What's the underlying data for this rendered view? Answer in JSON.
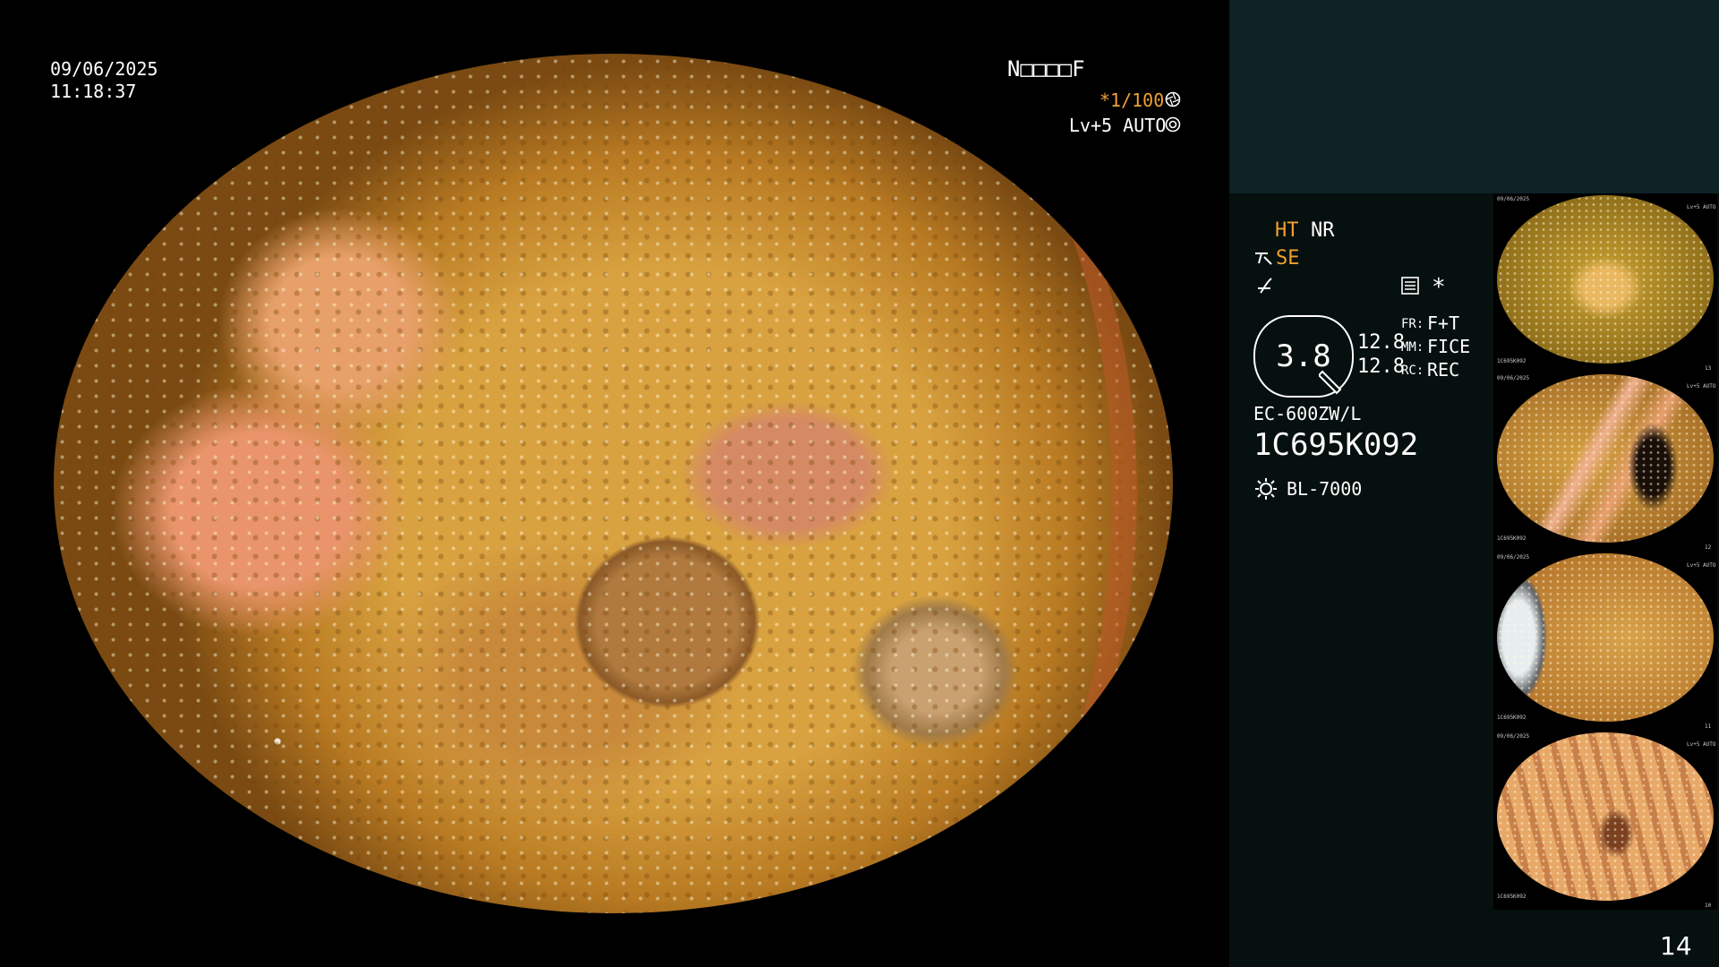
{
  "scope_overlay": {
    "date": "09/06/2025",
    "time": "11:18:37",
    "patient_code": "N□□□□F",
    "shutter": "*1/100",
    "level": "Lv+5 AUTO",
    "shutter_icon": "aperture-icon",
    "auto_icon": "iris-icon"
  },
  "panel": {
    "ht": "HT",
    "nr": "NR",
    "se": "SE",
    "fr_label": "FR:",
    "fr_value": "F+T",
    "mm_label": "MM:",
    "mm_value": "FICE",
    "rc_label": "RC:",
    "rc_value": "REC",
    "scale_value": "3.8",
    "val1": "12.8",
    "val2": "12.8",
    "asterisk": "*",
    "scope_model": "EC-600ZW/L",
    "serial": "1C695K092",
    "light_source": "BL-7000",
    "image_count": "14",
    "accent_color": "#f0a030"
  },
  "thumbnails": [
    {
      "date": "09/06/2025",
      "serial": "1C695K092",
      "level": "Lv+5 AUTO",
      "index": "13"
    },
    {
      "date": "09/06/2025",
      "serial": "1C695K092",
      "level": "Lv+5 AUTO",
      "index": "12"
    },
    {
      "date": "09/06/2025",
      "serial": "1C695K092",
      "level": "Lv+5 AUTO",
      "index": "11"
    },
    {
      "date": "09/06/2025",
      "serial": "1C695K092",
      "level": "Lv+5 AUTO",
      "index": "10"
    }
  ]
}
